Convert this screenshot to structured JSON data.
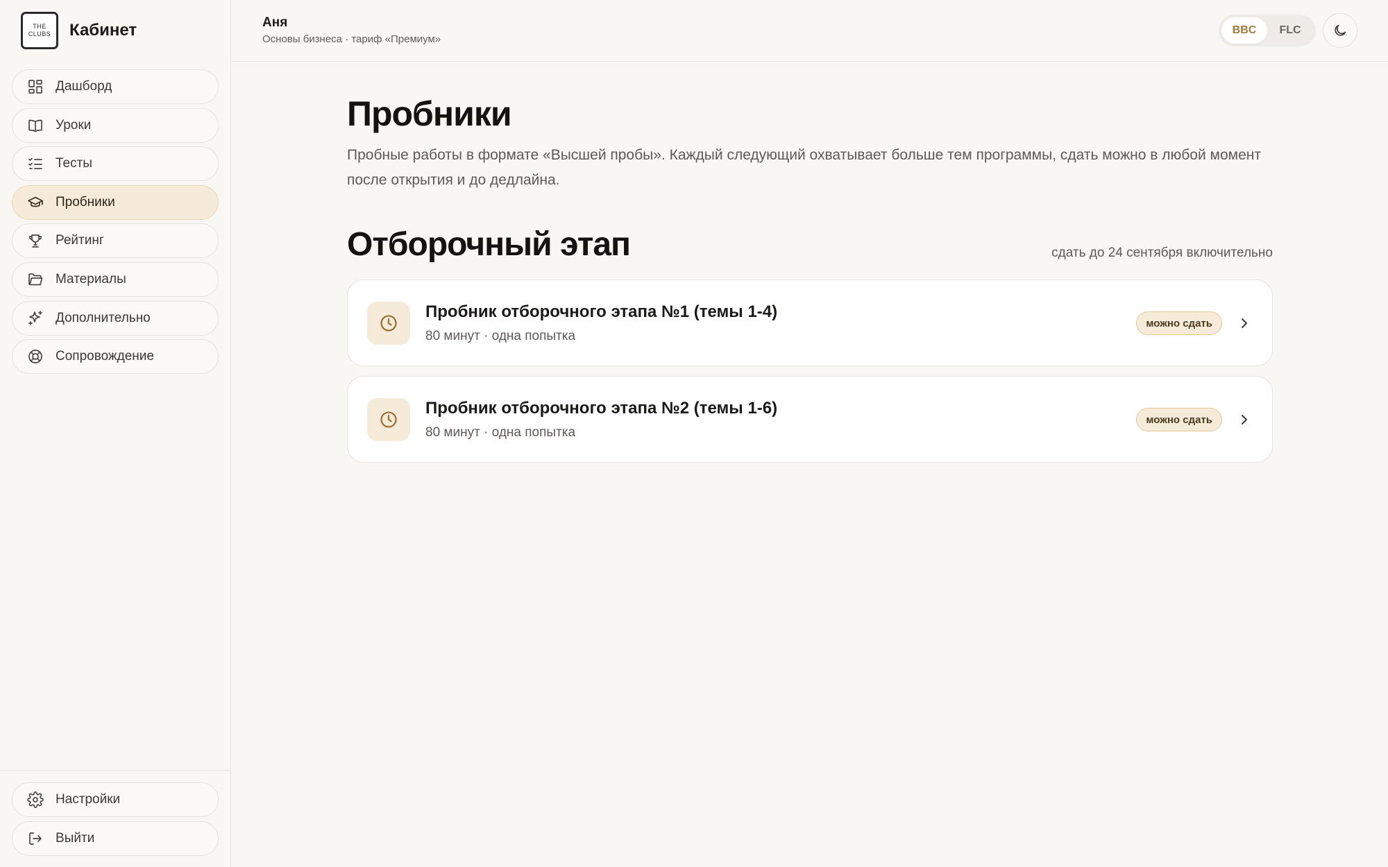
{
  "brand": {
    "logo_line1": "THE",
    "logo_line2": "CLUBS",
    "title": "Кабинет"
  },
  "sidebar": {
    "items": [
      {
        "label": "Дашборд",
        "icon": "dashboard-icon"
      },
      {
        "label": "Уроки",
        "icon": "book-icon"
      },
      {
        "label": "Тесты",
        "icon": "checklist-icon"
      },
      {
        "label": "Пробники",
        "icon": "graduation-cap-icon",
        "active": true
      },
      {
        "label": "Рейтинг",
        "icon": "trophy-icon"
      },
      {
        "label": "Материалы",
        "icon": "folder-icon"
      },
      {
        "label": "Дополнительно",
        "icon": "sparkles-icon"
      },
      {
        "label": "Сопровождение",
        "icon": "lifebuoy-icon"
      }
    ],
    "bottom": [
      {
        "label": "Настройки",
        "icon": "gear-icon"
      },
      {
        "label": "Выйти",
        "icon": "logout-icon"
      }
    ]
  },
  "header": {
    "user_name": "Аня",
    "user_subtitle": "Основы бизнеса · тариф «Премиум»",
    "toggle": {
      "options": [
        "BBC",
        "FLC"
      ],
      "selected": "BBC"
    },
    "theme_icon": "moon-icon"
  },
  "main": {
    "title": "Пробники",
    "description": "Пробные работы в формате «Высшей пробы». Каждый следующий охватывает больше тем программы, сдать можно в любой момент после открытия и до дедлайна.",
    "section": {
      "title": "Отборочный этап",
      "deadline_note": "сдать до 24 сентября включительно",
      "cards": [
        {
          "title": "Пробник отборочного этапа №1 (темы 1-4)",
          "subtitle": "80 минут · одна попытка",
          "badge": "можно сдать",
          "icon": "clock-icon"
        },
        {
          "title": "Пробник отборочного этапа №2 (темы 1-6)",
          "subtitle": "80 минут · одна попытка",
          "badge": "можно сдать",
          "icon": "clock-icon"
        }
      ]
    }
  },
  "colors": {
    "background": "#f8f7f4",
    "accent": "#a07b3a",
    "accent_soft": "#f6ebd8",
    "text": "#1b1a18",
    "muted": "#5d5954"
  }
}
